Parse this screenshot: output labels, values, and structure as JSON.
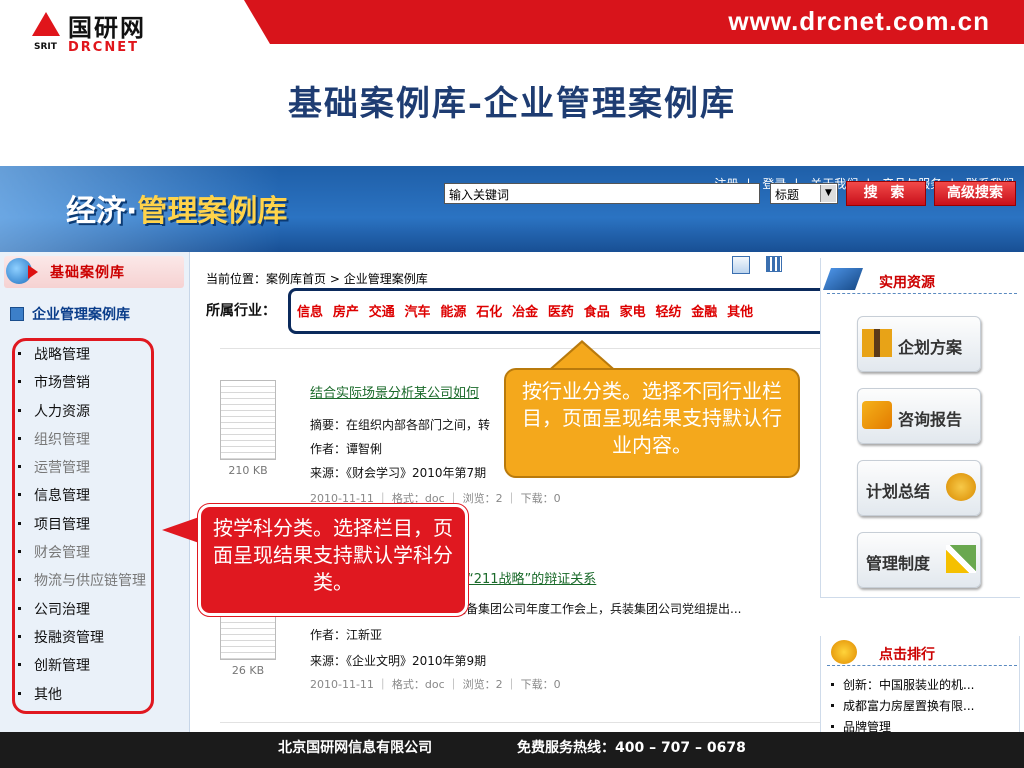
{
  "header": {
    "logo_cn": "国研网",
    "logo_srit": "SRIT",
    "logo_en": "DRCNET",
    "site_url": "www.drcnet.com.cn"
  },
  "slide_title": "基础案例库-企业管理案例库",
  "app": {
    "banner_title_part1": "经济·",
    "banner_title_part2": "管理案例库",
    "nav_links": [
      "注册",
      "登录",
      "关于我们",
      "产品与服务",
      "联系我们"
    ],
    "nav_separator": "|",
    "search": {
      "value": "输入关键词",
      "field_selected": "标题",
      "search_button": "搜 索",
      "advanced_button": "高级搜索"
    }
  },
  "sidebar": {
    "header": "基础案例库",
    "subheader": "企业管理案例库",
    "items": [
      {
        "label": "战略管理",
        "muted": false
      },
      {
        "label": "市场营销",
        "muted": false
      },
      {
        "label": "人力资源",
        "muted": false
      },
      {
        "label": "组织管理",
        "muted": true
      },
      {
        "label": "运营管理",
        "muted": true
      },
      {
        "label": "信息管理",
        "muted": false
      },
      {
        "label": "项目管理",
        "muted": false
      },
      {
        "label": "财会管理",
        "muted": true
      },
      {
        "label": "物流与供应链管理",
        "muted": true
      },
      {
        "label": "公司治理",
        "muted": false
      },
      {
        "label": "投融资管理",
        "muted": false
      },
      {
        "label": "创新管理",
        "muted": false
      },
      {
        "label": "其他",
        "muted": false
      }
    ]
  },
  "main": {
    "breadcrumb_prefix": "当前位置：",
    "breadcrumb_home": "案例库首页",
    "breadcrumb_sep": ">",
    "breadcrumb_current": "企业管理案例库",
    "industry_label": "所属行业：",
    "industries": [
      "信息",
      "房产",
      "交通",
      "汽车",
      "能源",
      "石化",
      "冶金",
      "医药",
      "食品",
      "家电",
      "轻纺",
      "金融",
      "其他"
    ],
    "items": [
      {
        "title": "结合实际场景分析某公司如何",
        "abstract": "摘要：在组织内部各部门之间，转",
        "author": "作者：谭智俐",
        "source": "来源：《财会学习》2010年第7期",
        "meta": "2010-11-11 ｜ 格式：doc ｜ 浏览：2 ｜ 下载：0",
        "size": "210 KB"
      },
      {
        "title": "与“211战略”的辩证关系",
        "abstract": "装备集团公司年度工作会上，兵装集团公司党组提出...",
        "author": "作者：江新亚",
        "source": "来源：《企业文明》2010年第9期",
        "meta": "2010-11-11 ｜ 格式：doc ｜ 浏览：2 ｜ 下载：0",
        "size": "26 KB"
      }
    ]
  },
  "rightbar": {
    "resources_title": "实用资源",
    "resources": [
      "企划方案",
      "咨询报告",
      "计划总结",
      "管理制度"
    ],
    "ranking_title": "点击排行",
    "ranking": [
      "创新：中国服装业的机...",
      "成都富力房屋置换有限...",
      "品牌管理"
    ]
  },
  "callouts": {
    "industry": "按行业分类。选择不同行业栏目，页面呈现结果支持默认行业内容。",
    "subject": "按学科分类。选择栏目，页面呈现结果支持默认学科分类。"
  },
  "footer": {
    "company": "北京国研网信息有限公司",
    "hotline": "免费服务热线：400 – 707 – 0678"
  },
  "colors": {
    "brand_red": "#d8141b",
    "title_blue": "#1e3c72",
    "callout_orange": "#f4a81c",
    "industry_red": "#dd0000",
    "link_green": "#1a6a2a"
  }
}
